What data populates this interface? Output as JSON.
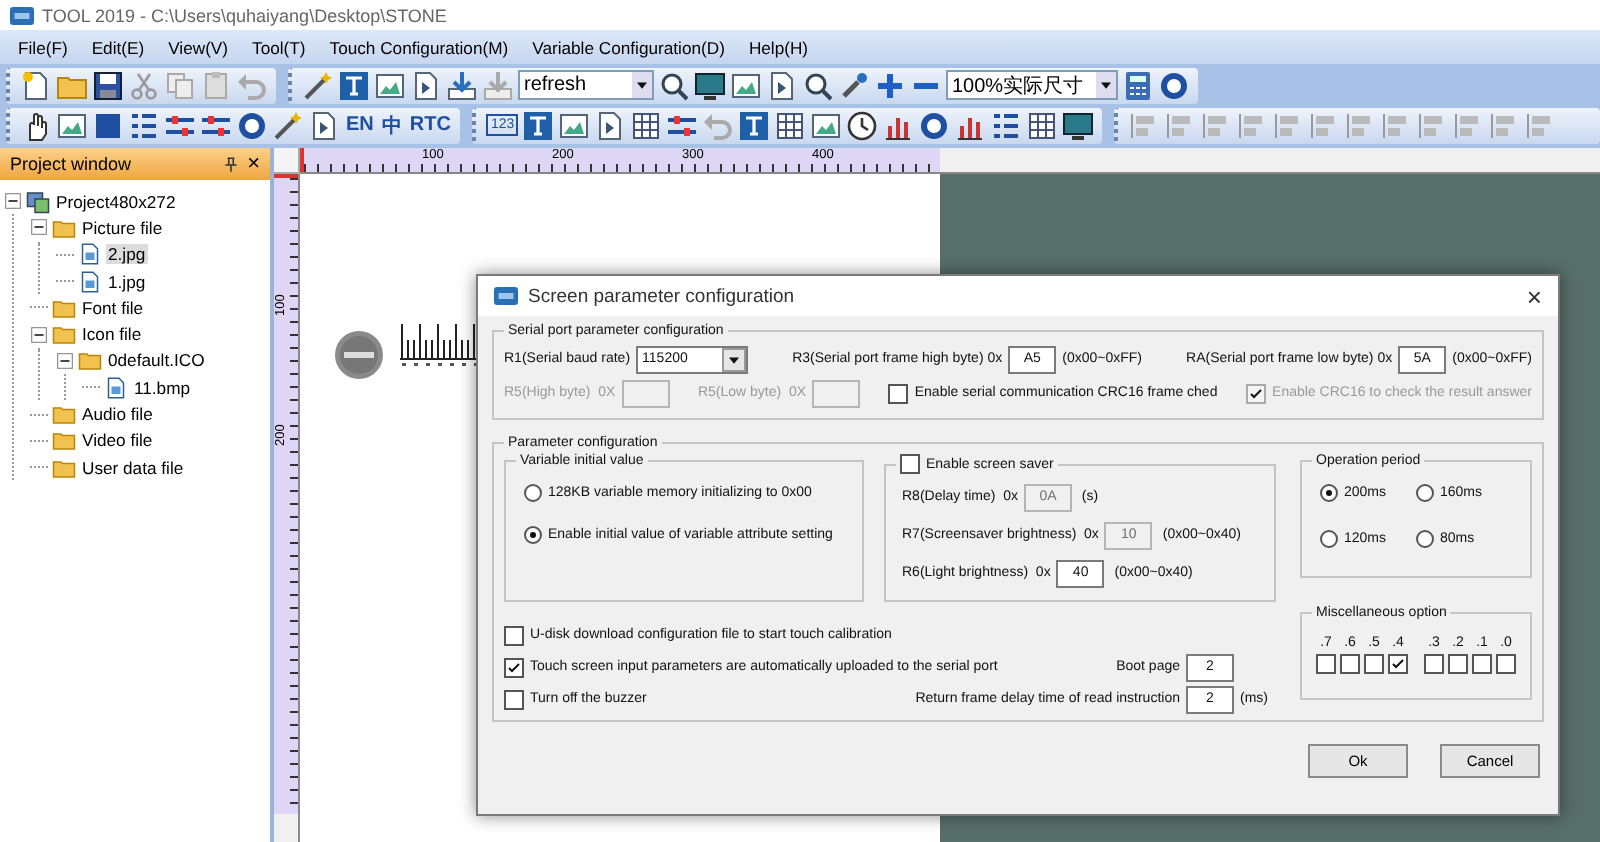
{
  "window": {
    "title": "TOOL 2019 - C:\\Users\\quhaiyang\\Desktop\\STONE"
  },
  "menu": [
    "File(F)",
    "Edit(E)",
    "View(V)",
    "Tool(T)",
    "Touch Configuration(M)",
    "Variable Configuration(D)",
    "Help(H)"
  ],
  "toolbar": {
    "page_combo": "refresh",
    "zoom_combo": "100%实际尺寸",
    "text_buttons": [
      "EN",
      "中",
      "RTC"
    ],
    "number_button": "123"
  },
  "project_window": {
    "title": "Project window",
    "close": "×",
    "tree": [
      {
        "label": "Project480x272",
        "kind": "project",
        "selected": false,
        "expanded": true,
        "children": [
          {
            "label": "Picture file",
            "kind": "folder",
            "selected": false,
            "expanded": true,
            "children": [
              {
                "label": "2.jpg",
                "kind": "file",
                "selected": true
              },
              {
                "label": "1.jpg",
                "kind": "file",
                "selected": false
              }
            ]
          },
          {
            "label": "Font file",
            "kind": "folder",
            "selected": false
          },
          {
            "label": "Icon file",
            "kind": "folder",
            "selected": false,
            "expanded": true,
            "children": [
              {
                "label": "0default.ICO",
                "kind": "folder",
                "selected": false,
                "expanded": true,
                "children": [
                  {
                    "label": "11.bmp",
                    "kind": "file",
                    "selected": false
                  }
                ]
              }
            ]
          },
          {
            "label": "Audio file",
            "kind": "folder",
            "selected": false
          },
          {
            "label": "Video file",
            "kind": "folder",
            "selected": false
          },
          {
            "label": "User data file",
            "kind": "folder",
            "selected": false
          }
        ]
      }
    ]
  },
  "ruler": {
    "horizontal": [
      "100",
      "200",
      "300",
      "400"
    ],
    "vertical": [
      "100",
      "200"
    ]
  },
  "dialog": {
    "title": "Screen parameter configuration",
    "close": "×",
    "serial": {
      "title": "Serial port parameter configuration",
      "baud": {
        "label": "R1(Serial baud rate)",
        "value": "115200"
      },
      "high": {
        "label": "R3(Serial port frame high byte) 0x",
        "value": "A5",
        "range": "(0x00~0xFF)"
      },
      "low": {
        "label": "RA(Serial port frame low byte) 0x",
        "value": "5A",
        "range": "(0x00~0xFF)"
      },
      "crc_fields": [
        {
          "label": "R5(High byte)  0X",
          "disabled": true
        },
        {
          "label": "R5(Low byte)  0X",
          "disabled": true
        }
      ],
      "options": [
        {
          "label": "Enable serial communication CRC16 frame ched",
          "checked": false,
          "disabled": false
        },
        {
          "label": "Enable CRC16 to check the result answer",
          "checked": true,
          "disabled": true
        }
      ]
    },
    "params": {
      "title": "Parameter configuration",
      "initial": {
        "title": "Variable initial value",
        "options": [
          {
            "label": "128KB variable memory initializing to 0x00",
            "selected": false
          },
          {
            "label": "Enable initial value of variable attribute setting",
            "selected": true
          }
        ]
      },
      "saver": {
        "label": "Enable screen saver",
        "checked": false,
        "fields": [
          {
            "label": "R8(Delay time)  0x",
            "value": "0A",
            "suffix": "(s)",
            "disabled": true
          },
          {
            "label": "R7(Screensaver brightness)  0x",
            "value": "10",
            "suffix": "(0x00~0x40)",
            "disabled": true
          },
          {
            "label": "R6(Light brightness)  0x",
            "value": "40",
            "suffix": "(0x00~0x40)",
            "disabled": false
          }
        ]
      },
      "period": {
        "title": "Operation period",
        "options": [
          {
            "label": "200ms",
            "selected": true
          },
          {
            "label": "160ms",
            "selected": false
          },
          {
            "label": "120ms",
            "selected": false
          },
          {
            "label": "80ms",
            "selected": false
          }
        ]
      },
      "checks": [
        {
          "label": "U-disk download configuration file to start touch calibration",
          "checked": false
        },
        {
          "label": "Touch screen input parameters are automatically uploaded to the serial port",
          "checked": true
        },
        {
          "label": "Turn off the buzzer",
          "checked": false
        }
      ],
      "boot_page": {
        "label": "Boot page",
        "value": "2"
      },
      "return_delay": {
        "label": "Return frame delay time of read instruction",
        "value": "2",
        "suffix": "(ms)"
      },
      "misc": {
        "title": "Miscellaneous option",
        "bits": [
          {
            "label": ".7",
            "checked": false
          },
          {
            "label": ".6",
            "checked": false
          },
          {
            "label": ".5",
            "checked": false
          },
          {
            "label": ".4",
            "checked": true
          },
          {
            "label": ".3",
            "checked": false
          },
          {
            "label": ".2",
            "checked": false
          },
          {
            "label": ".1",
            "checked": false
          },
          {
            "label": ".0",
            "checked": false
          }
        ]
      }
    },
    "buttons": [
      "Ok",
      "Cancel"
    ]
  }
}
